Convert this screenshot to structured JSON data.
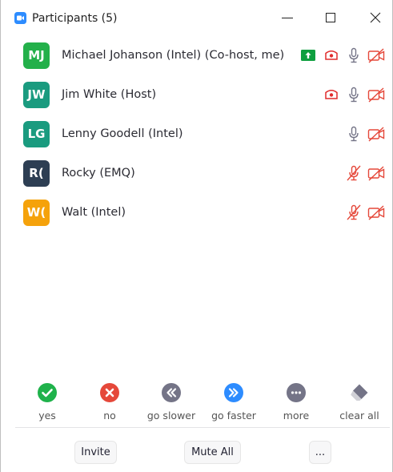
{
  "window": {
    "title": "Participants (5)",
    "accent": "#2d8cff"
  },
  "participants": [
    {
      "initials": "MJ",
      "name": "Michael Johanson (Intel) (Co-host, me)",
      "avatar_color": "#23b04a",
      "sharing": true,
      "recording": true,
      "mic": "on",
      "video": "off"
    },
    {
      "initials": "JW",
      "name": "Jim White (Host)",
      "avatar_color": "#1a9b7f",
      "sharing": false,
      "recording": true,
      "mic": "on",
      "video": "off"
    },
    {
      "initials": "LG",
      "name": "Lenny Goodell (Intel)",
      "avatar_color": "#1a9b7f",
      "sharing": false,
      "recording": false,
      "mic": "on",
      "video": "off"
    },
    {
      "initials": "R(",
      "name": "Rocky (EMQ)",
      "avatar_color": "#2d3e53",
      "sharing": false,
      "recording": false,
      "mic": "muted",
      "video": "off"
    },
    {
      "initials": "W(",
      "name": "Walt (Intel)",
      "avatar_color": "#f5a20b",
      "sharing": false,
      "recording": false,
      "mic": "muted",
      "video": "off"
    }
  ],
  "reactions": [
    {
      "label": "yes",
      "icon": "check-icon",
      "color": "#1fb24b"
    },
    {
      "label": "no",
      "icon": "x-icon",
      "color": "#e5483a"
    },
    {
      "label": "go slower",
      "icon": "double-chevron-left-icon",
      "color": "#747487"
    },
    {
      "label": "go faster",
      "icon": "double-chevron-right-icon",
      "color": "#2d8cff"
    },
    {
      "label": "more",
      "icon": "ellipsis-icon",
      "color": "#747487"
    },
    {
      "label": "clear all",
      "icon": "eraser-icon",
      "color": "#747487"
    }
  ],
  "footer": {
    "invite_label": "Invite",
    "mute_all_label": "Mute All",
    "more_label": "..."
  },
  "status_colors": {
    "muted_red": "#e5483a",
    "recording_red": "#e02c2c",
    "share_green": "#0e9f3f",
    "icon_gray": "#747487"
  }
}
